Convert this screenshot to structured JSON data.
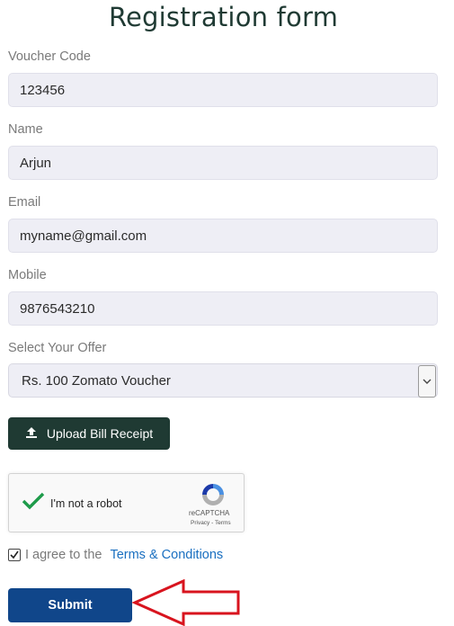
{
  "title": "Registration form",
  "fields": [
    {
      "label": "Voucher Code",
      "value": "123456"
    },
    {
      "label": "Name",
      "value": "Arjun"
    },
    {
      "label": "Email",
      "value": "myname@gmail.com"
    },
    {
      "label": "Mobile",
      "value": "9876543210"
    }
  ],
  "offer": {
    "label": "Select Your Offer",
    "selected": "Rs. 100 Zomato Voucher"
  },
  "upload": {
    "label": "Upload Bill Receipt",
    "icon": "upload-icon"
  },
  "captcha": {
    "text": "I'm not a robot",
    "brand": "reCAPTCHA",
    "links": "Privacy - Terms",
    "checked": true
  },
  "agree": {
    "text": "I agree to the",
    "link": "Terms & Conditions",
    "checked": true
  },
  "submit": {
    "label": "Submit"
  },
  "colors": {
    "title": "#1f3a33",
    "upload_btn": "#1f3a33",
    "submit_btn": "#10468a",
    "annotation_arrow": "#d8141e",
    "link": "#1a6fc0"
  }
}
